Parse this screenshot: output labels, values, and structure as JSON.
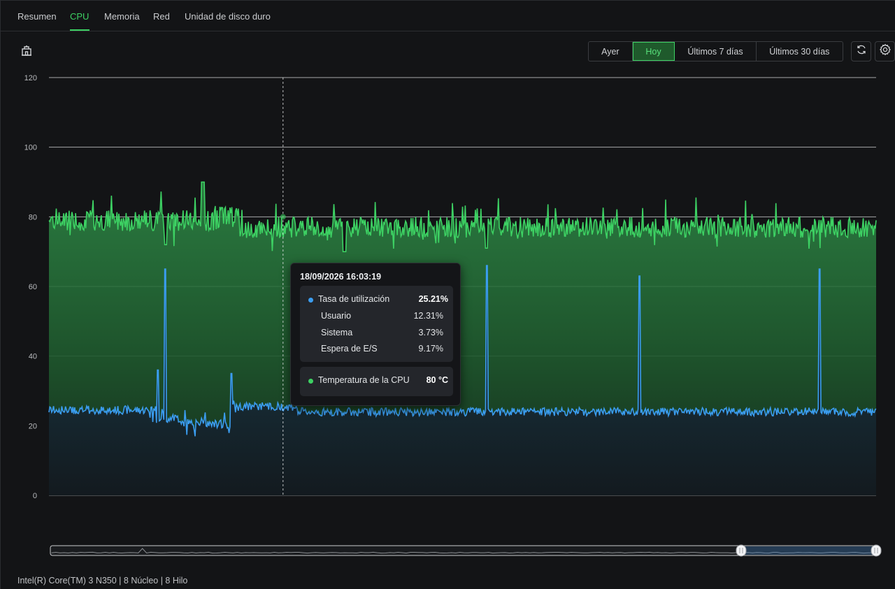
{
  "tabs": [
    {
      "label": "Resumen",
      "active": false
    },
    {
      "label": "CPU",
      "active": true
    },
    {
      "label": "Memoria",
      "active": false
    },
    {
      "label": "Red",
      "active": false
    },
    {
      "label": "Unidad de disco duro",
      "active": false
    }
  ],
  "toolbar": {
    "left_icon": "building-icon",
    "ranges": [
      {
        "label": "Ayer",
        "active": false
      },
      {
        "label": "Hoy",
        "active": true
      },
      {
        "label": "Últimos 7 días",
        "active": false
      },
      {
        "label": "Últimos 30 días",
        "active": false
      }
    ],
    "refresh_icon": "refresh-icon",
    "settings_icon": "gear-icon"
  },
  "colors": {
    "accent": "#3dd163",
    "temperature_series": "#3dd163",
    "utilization_series": "#3b9df0",
    "background": "#131416"
  },
  "tooltip": {
    "time": "18/09/2026 16:03:19",
    "utilization_label": "Tasa de utilización",
    "utilization_value": "25.21%",
    "user_label": "Usuario",
    "user_value": "12.31%",
    "system_label": "Sistema",
    "system_value": "3.73%",
    "io_label": "Espera de E/S",
    "io_value": "9.17%",
    "temp_label": "Temperatura de la CPU",
    "temp_value": "80 °C"
  },
  "chart_data": {
    "type": "area",
    "ylim": [
      0,
      120
    ],
    "yticks": [
      0,
      20,
      40,
      60,
      80,
      100,
      120
    ],
    "grid": true,
    "series": [
      {
        "key": "temperature",
        "color": "#3dd163",
        "baseline": 77,
        "noise": 3,
        "segments": [
          {
            "from": 0.0,
            "to": 0.205,
            "level": 79
          },
          {
            "from": 0.205,
            "to": 0.215,
            "level": 81
          },
          {
            "from": 0.215,
            "to": 0.21,
            "level": 79
          },
          {
            "from": 0.21,
            "to": 0.23,
            "level": 81
          },
          {
            "from": 0.23,
            "to": 1.0,
            "level": 77
          }
        ]
      },
      {
        "key": "utilization",
        "color": "#3b9df0",
        "baseline": 24,
        "noise": 1.2,
        "spikes": [
          {
            "at": 0.141,
            "value": 65
          },
          {
            "at": 0.132,
            "value": 36
          },
          {
            "at": 0.221,
            "value": 35
          },
          {
            "at": 0.529,
            "value": 66
          },
          {
            "at": 0.714,
            "value": 63
          },
          {
            "at": 0.932,
            "value": 65
          }
        ]
      }
    ],
    "cursor_fraction": 0.283
  },
  "footer": {
    "cpu_info": "Intel(R) Core(TM) 3 N350 | 8 Núcleo | 8 Hilo"
  }
}
